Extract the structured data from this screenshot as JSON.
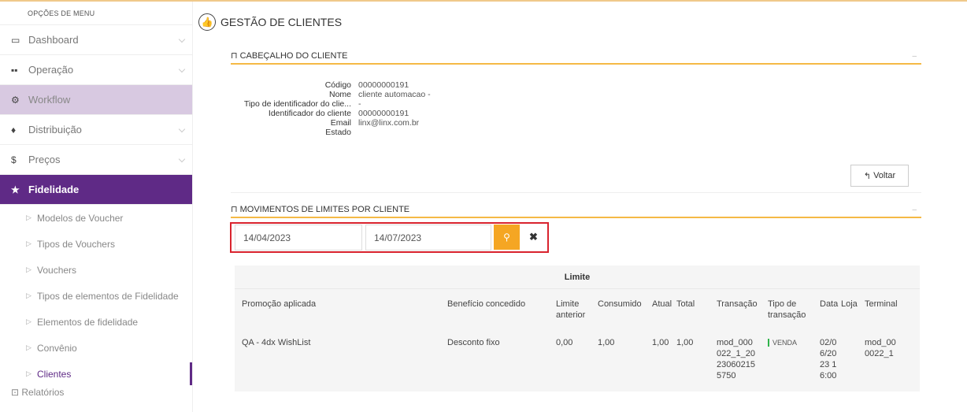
{
  "sidebar": {
    "title": "OPÇÕES DE MENU",
    "items": [
      {
        "label": "Dashboard",
        "icon": "laptop-icon"
      },
      {
        "label": "Operação",
        "icon": "grid-icon"
      },
      {
        "label": "Workflow",
        "icon": "gear-icon"
      },
      {
        "label": "Distribuição",
        "icon": "map-marker-icon"
      },
      {
        "label": "Preços",
        "icon": "dollar-icon"
      },
      {
        "label": "Fidelidade",
        "icon": "star-icon"
      }
    ],
    "subitems": [
      "Modelos de Voucher",
      "Tipos de Vouchers",
      "Vouchers",
      "Tipos de elementos de Fidelidade",
      "Elementos de fidelidade",
      "Convênio",
      "Clientes"
    ],
    "next_item": "Relatórios"
  },
  "page": {
    "title": "GESTÃO DE CLIENTES"
  },
  "header_panel": {
    "title": "CABEÇALHO DO CLIENTE",
    "fields": [
      {
        "label": "Código",
        "value": "00000000191"
      },
      {
        "label": "Nome",
        "value": "cliente automacao -"
      },
      {
        "label": "Tipo de identificador do clie...",
        "value": "-"
      },
      {
        "label": "Identificador do cliente",
        "value": "00000000191"
      },
      {
        "label": "Email",
        "value": "linx@linx.com.br"
      },
      {
        "label": "Estado",
        "value": ""
      }
    ],
    "back_button": "Voltar"
  },
  "movements_panel": {
    "title": "MOVIMENTOS DE LIMITES POR CLIENTE",
    "date_from": "14/04/2023",
    "date_to": "14/07/2023",
    "table": {
      "group_header": "Limite",
      "columns": [
        "Promoção aplicada",
        "Benefício concedido",
        "Limite anterior",
        "Consumido",
        "Atual",
        "Total",
        "Transação",
        "Tipo de transação",
        "Data",
        "Loja",
        "Terminal"
      ],
      "rows": [
        {
          "promocao": "QA - 4dx WishList",
          "beneficio": "Desconto fixo",
          "limite_anterior": "0,00",
          "consumido": "1,00",
          "atual": "1,00",
          "total": "1,00",
          "transacao": "mod_000 022_1_20 23060215 5750",
          "tipo": "VENDA",
          "data": "02/0 6/20 23 1 6:00",
          "loja": "",
          "terminal": "mod_00 0022_1"
        }
      ]
    }
  },
  "colors": {
    "accent": "#5f2a86",
    "orange": "#f5a623",
    "highlight": "#d9232e",
    "workflow_bg": "#d8c9e1"
  }
}
